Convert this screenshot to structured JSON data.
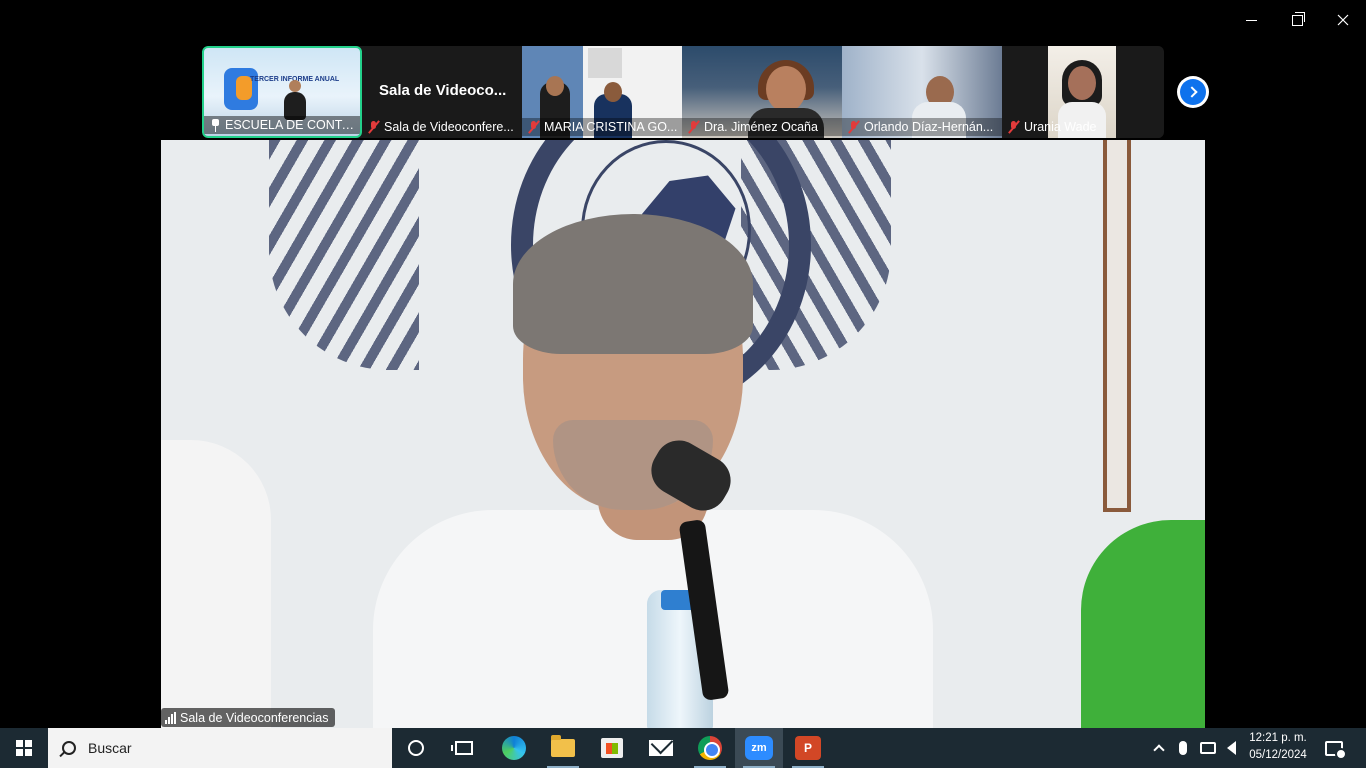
{
  "window": {
    "controls": {
      "minimize": "minimize",
      "maximize": "restore",
      "close": "close"
    }
  },
  "participants": [
    {
      "name": "ESCUELA DE CONTA...",
      "muted": false,
      "pinned": true,
      "active_speaker": true,
      "banner": "TERCER INFORME ANUAL"
    },
    {
      "name": "Sala de Videoconfere...",
      "muted": true,
      "display_name": "Sala de Videoco..."
    },
    {
      "name": "MARIA CRISTINA GO...",
      "muted": true
    },
    {
      "name": "Dra. Jiménez Ocaña",
      "muted": true
    },
    {
      "name": "Orlando Díaz-Hernán...",
      "muted": true
    },
    {
      "name": "Urania Wade",
      "muted": true
    }
  ],
  "main_video": {
    "speaker_label": "Sala de Videoconferencias"
  },
  "taskbar": {
    "search_placeholder": "Buscar",
    "apps": [
      "cortana",
      "task-view",
      "edge",
      "file-explorer",
      "microsoft-store",
      "mail",
      "chrome",
      "zoom",
      "powerpoint"
    ],
    "zoom_label": "zm",
    "ppt_label": "P",
    "clock_time": "12:21 p. m.",
    "clock_date": "05/12/2024"
  },
  "colors": {
    "active_border": "#23d18b",
    "muted_red": "#e23b3b",
    "zoom_blue": "#0e72ed",
    "taskbar_bg": "#1c2a33"
  }
}
